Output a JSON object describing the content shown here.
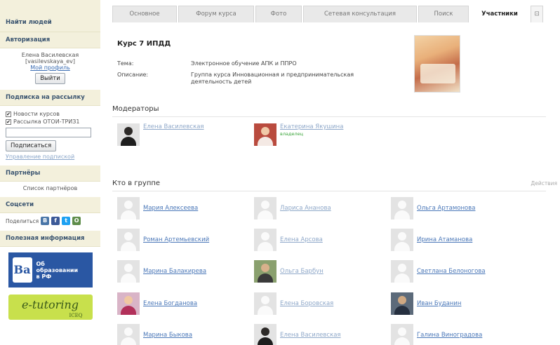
{
  "sidebar": {
    "find_people": "Найти людей",
    "auth": {
      "title": "Авторизация",
      "user_name": "Елена Василевская",
      "user_login": "[vasilevskaya_ev]",
      "profile_link": "Мой профиль",
      "logout_label": "Выйти"
    },
    "subscription": {
      "title": "Подписка на рассылку",
      "options": [
        {
          "label": "Новости курсов",
          "checked": "✔"
        },
        {
          "label": "Рассылка ОТОИ-ТРИЗ1",
          "checked": "✔"
        }
      ],
      "subscribe_label": "Подписаться",
      "manage_link": "Управление подпиской"
    },
    "partners": {
      "title": "Партнёры",
      "list_label": "Список партнёров"
    },
    "social": {
      "title": "Соцсети",
      "share_label": "Поделиться",
      "icons": [
        "vk-icon",
        "facebook-icon",
        "twitter-icon",
        "odnoklassniki-icon"
      ],
      "colors": [
        "#4a76a8",
        "#3b5998",
        "#1da1f2",
        "#5e8c4a"
      ],
      "glyphs": [
        "В",
        "f",
        "t",
        "О"
      ]
    },
    "useful": {
      "title": "Полезная информация",
      "banner1_logo": "Ba",
      "banner1_text": [
        "Об",
        "образовании",
        "в РФ"
      ],
      "banner2_text": "e-tutoring",
      "banner2_sub": "ICEQ"
    }
  },
  "tabs": [
    {
      "label": "Основное",
      "active": false
    },
    {
      "label": "Форум курса",
      "active": false
    },
    {
      "label": "Фото",
      "active": false
    },
    {
      "label": "Сетевая консультация",
      "active": false
    },
    {
      "label": "Поиск",
      "active": false
    },
    {
      "label": "Участники",
      "active": true
    },
    {
      "label": "⊡",
      "active": false
    }
  ],
  "course": {
    "title": "Курс 7 ИПДД",
    "theme_label": "Тема:",
    "theme_value": "Электронное обучение АПК и ППРО",
    "desc_label": "Описание:",
    "desc_value": "Группа курса Инновационная и предпринимательская деятельность детей"
  },
  "moderators": {
    "title": "Модераторы",
    "people": [
      {
        "name": "Елена Василевская",
        "sub": ""
      },
      {
        "name": "Екатерина Якушина",
        "sub": "владелец"
      }
    ]
  },
  "members": {
    "title": "Кто в группе",
    "actions_label": "Действия",
    "people": [
      {
        "name": "Мария Алексеева"
      },
      {
        "name": "Лариса Ананова"
      },
      {
        "name": "Ольга Артамонова"
      },
      {
        "name": "Роман Артемьевский"
      },
      {
        "name": "Елена Арсова"
      },
      {
        "name": "Ирина Атаманова"
      },
      {
        "name": "Марина Балакирева"
      },
      {
        "name": "Ольга Барбун"
      },
      {
        "name": "Светлана Белоногова"
      },
      {
        "name": "Елена Богданова"
      },
      {
        "name": "Елена Боровская"
      },
      {
        "name": "Иван Буданин"
      },
      {
        "name": "Марина Быкова"
      },
      {
        "name": "Елена Василевская"
      },
      {
        "name": "Галина Виноградова"
      }
    ]
  }
}
